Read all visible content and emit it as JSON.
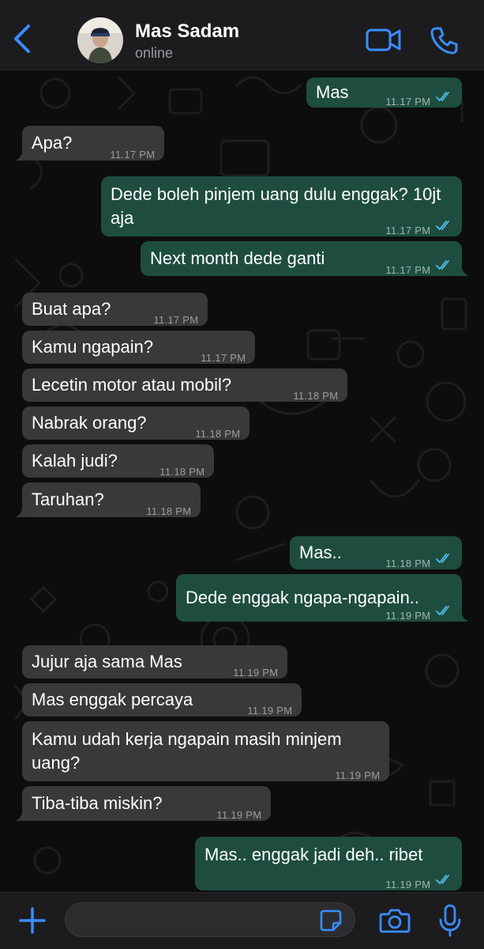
{
  "header": {
    "contact_name": "Mas Sadam",
    "status": "online"
  },
  "colors": {
    "accent": "#3a8dff",
    "incoming_bubble": "#39393b",
    "outgoing_bubble": "#1e4d40",
    "read_tick": "#53bdeb"
  },
  "icons": {
    "back": "chevron-left-icon",
    "video": "video-camera-icon",
    "call": "phone-icon",
    "plus": "plus-icon",
    "sticker": "sticker-icon",
    "camera": "camera-icon",
    "mic": "microphone-icon",
    "read": "double-check-icon"
  },
  "messages": [
    {
      "dir": "out",
      "text": "Mas",
      "time": "11.17 PM",
      "read": true
    },
    {
      "dir": "in",
      "text": "Apa?",
      "time": "11.17 PM"
    },
    {
      "dir": "out",
      "text": "Dede boleh pinjem uang dulu enggak? 10jt aja",
      "time": "11.17 PM",
      "read": true
    },
    {
      "dir": "out",
      "text": "Next month dede ganti",
      "time": "11.17 PM",
      "read": true
    },
    {
      "dir": "in",
      "text": "Buat apa?",
      "time": "11.17 PM"
    },
    {
      "dir": "in",
      "text": "Kamu ngapain?",
      "time": "11.17 PM"
    },
    {
      "dir": "in",
      "text": "Lecetin motor atau mobil?",
      "time": "11.18 PM"
    },
    {
      "dir": "in",
      "text": "Nabrak orang?",
      "time": "11.18 PM"
    },
    {
      "dir": "in",
      "text": "Kalah judi?",
      "time": "11.18 PM"
    },
    {
      "dir": "in",
      "text": "Taruhan?",
      "time": "11.18 PM"
    },
    {
      "dir": "out",
      "text": "Mas..",
      "time": "11.18 PM",
      "read": true
    },
    {
      "dir": "out",
      "text": "Dede enggak ngapa-ngapain..",
      "time": "11.19 PM",
      "read": true
    },
    {
      "dir": "in",
      "text": "Jujur aja sama Mas",
      "time": "11.19 PM"
    },
    {
      "dir": "in",
      "text": "Mas enggak percaya",
      "time": "11.19 PM"
    },
    {
      "dir": "in",
      "text": "Kamu udah kerja ngapain masih minjem uang?",
      "time": "11.19 PM"
    },
    {
      "dir": "in",
      "text": "Tiba-tiba miskin?",
      "time": "11.19 PM"
    },
    {
      "dir": "out",
      "text": "Mas.. enggak jadi deh.. ribet",
      "time": "11.19 PM",
      "read": true
    }
  ],
  "input": {
    "value": "",
    "placeholder": ""
  }
}
